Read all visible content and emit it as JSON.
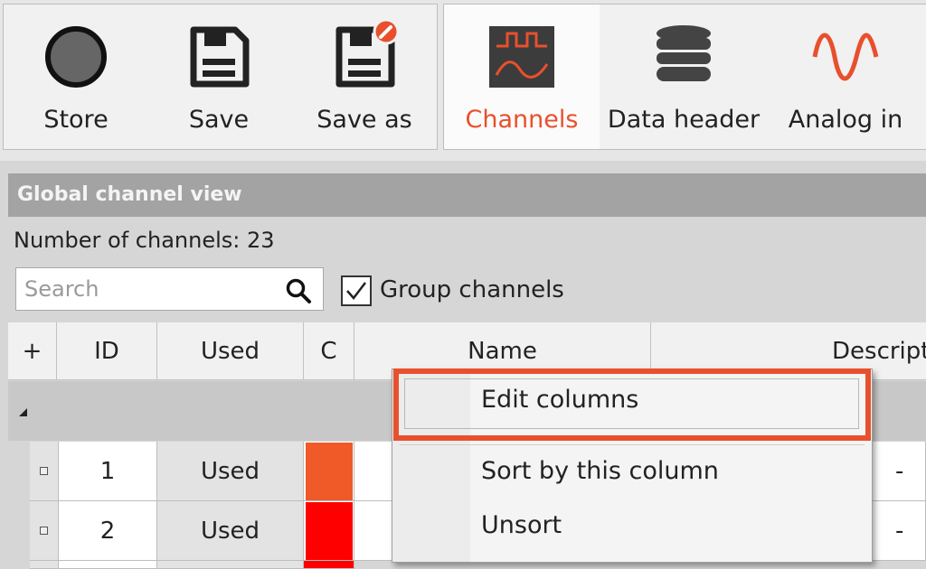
{
  "ribbon": {
    "buttons": [
      {
        "label": "Store",
        "icon": "store-icon"
      },
      {
        "label": "Save",
        "icon": "save-icon"
      },
      {
        "label": "Save as",
        "icon": "save-as-icon"
      },
      {
        "label": "Channels",
        "icon": "channels-icon",
        "active": true
      },
      {
        "label": "Data header",
        "icon": "database-icon"
      },
      {
        "label": "Analog in",
        "icon": "sine-wave-icon"
      }
    ]
  },
  "panel": {
    "title": "Global channel view",
    "count_text": "Number of channels: 23",
    "search_placeholder": "Search",
    "group_channels_label": "Group channels",
    "group_channels_checked": true
  },
  "grid": {
    "columns": [
      "+",
      "ID",
      "Used",
      "C",
      "Name",
      "Descript"
    ],
    "rows": [
      {
        "id": "1",
        "used": "Used",
        "color": "#ef5a28",
        "description": "-"
      },
      {
        "id": "2",
        "used": "Used",
        "color": "#ff0000",
        "description": "-"
      }
    ]
  },
  "context_menu": {
    "items": [
      "Edit columns",
      "Sort by this column",
      "Unsort"
    ],
    "highlighted": "Edit columns"
  },
  "colors": {
    "accent": "#e8502d",
    "panel_header": "#a3a3a3",
    "ribbon_bg": "#f1f1f1"
  }
}
